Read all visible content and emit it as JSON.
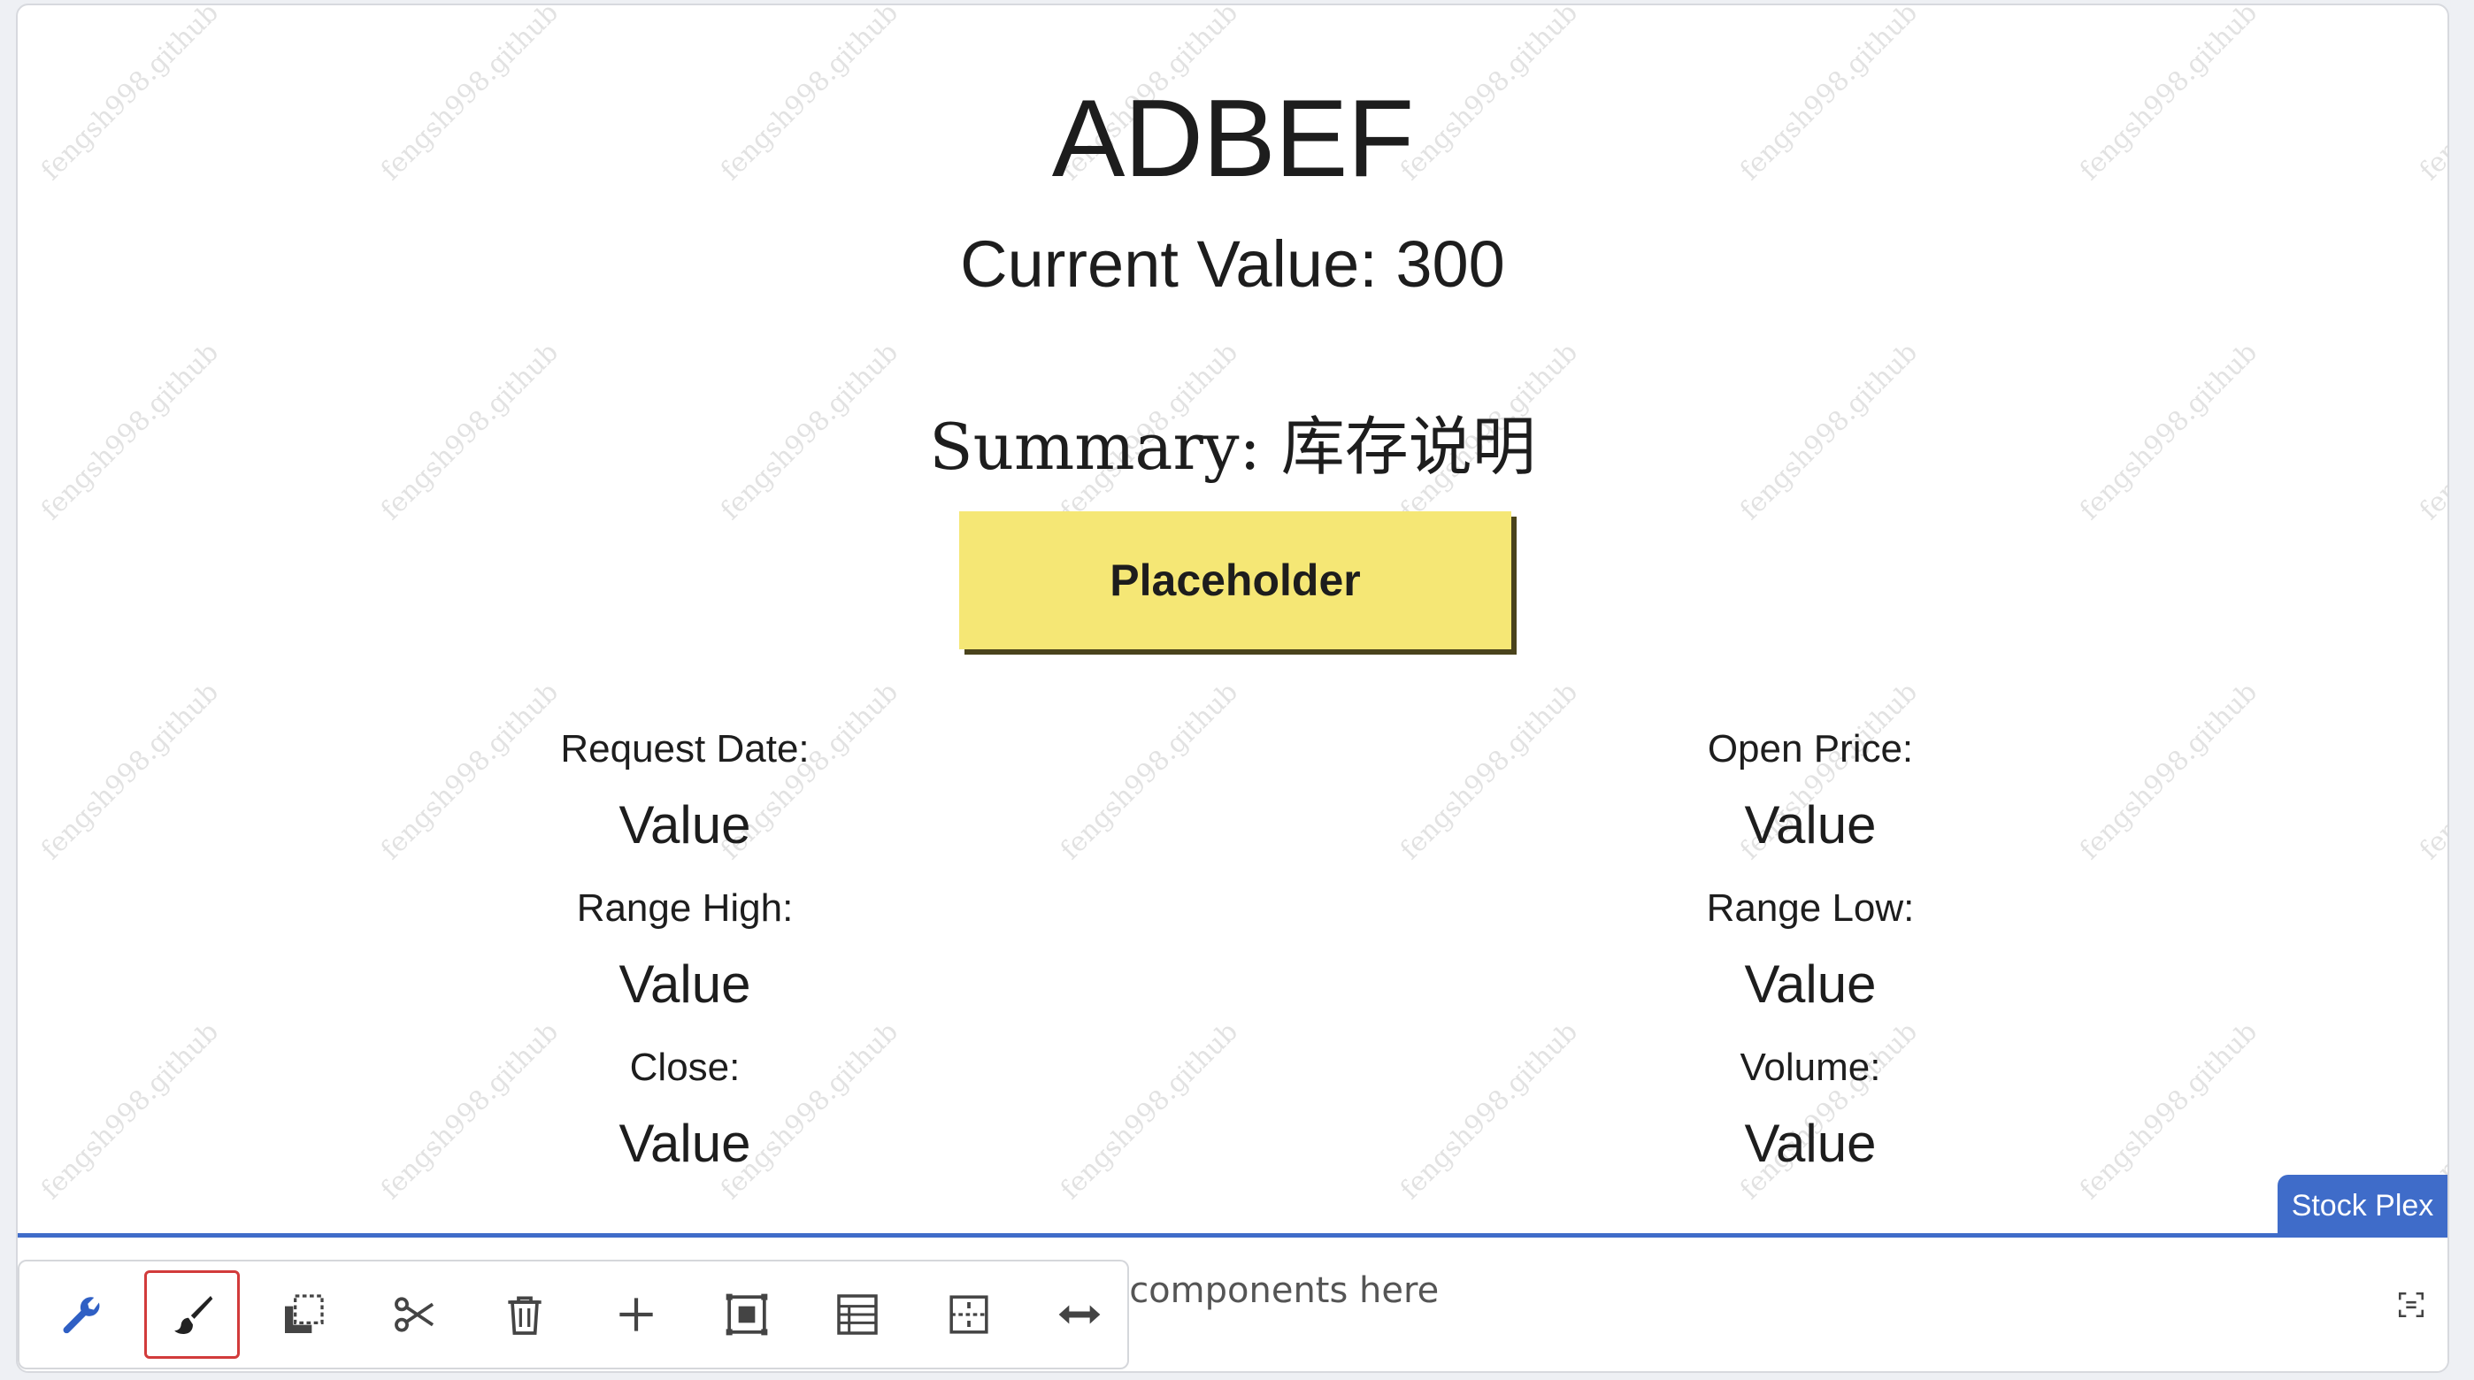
{
  "page": {
    "title": "ADBEF",
    "current_value_text": "Current Value: 300",
    "summary_label": "Summary: ",
    "summary_value": "库存说明",
    "primary_button_label": "Placeholder"
  },
  "fields": {
    "request_date": {
      "label": "Request Date:",
      "value": "Value"
    },
    "open_price": {
      "label": "Open Price:",
      "value": "Value"
    },
    "range_high": {
      "label": "Range High:",
      "value": "Value"
    },
    "range_low": {
      "label": "Range Low:",
      "value": "Value"
    },
    "close": {
      "label": "Close:",
      "value": "Value"
    },
    "volume": {
      "label": "Volume:",
      "value": "Value"
    }
  },
  "stock_tab_label": "Stock Plex",
  "drop_hint": "; components here",
  "watermark_text": "fengsh998.github",
  "toolbar": {
    "tools": [
      "wrench-icon",
      "brush-icon",
      "copy-icon",
      "scissors-icon",
      "trash-icon",
      "plus-icon",
      "frame-icon",
      "table-icon",
      "layout-icon",
      "resize-horizontal-icon"
    ],
    "active_tool": "brush-icon"
  },
  "colors": {
    "accent": "#3f6cc9",
    "button_bg": "#f5e775",
    "active_tool_border": "#d23b3b"
  }
}
